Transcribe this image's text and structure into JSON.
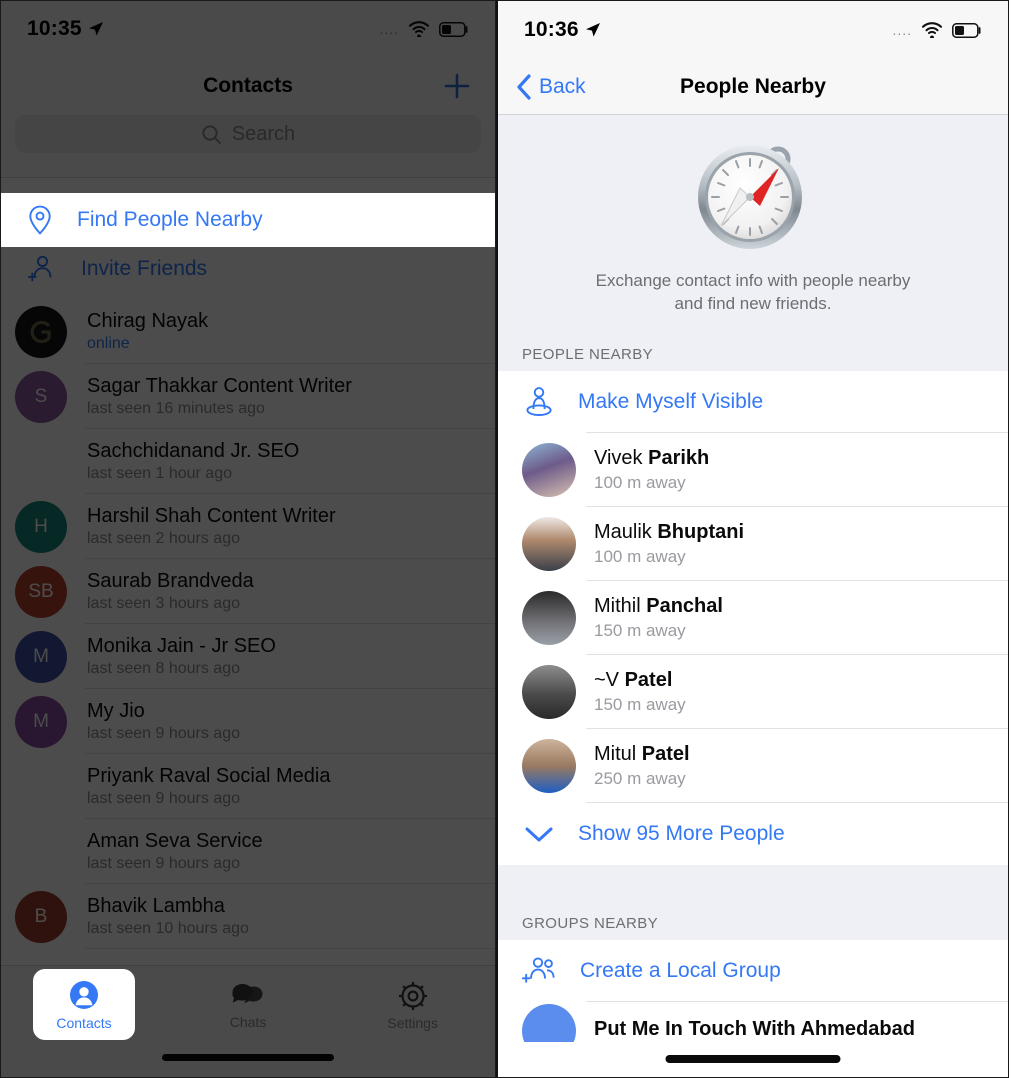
{
  "left": {
    "status": {
      "time": "10:35",
      "location_icon": "location-arrow-icon",
      "signal": "....",
      "wifi_icon": "wifi-icon",
      "battery_icon": "battery-icon"
    },
    "navbar": {
      "title": "Contacts",
      "add_icon": "plus-icon"
    },
    "search": {
      "placeholder": "Search",
      "icon": "search-icon"
    },
    "actions": [
      {
        "label": "Find People Nearby",
        "icon": "map-pin-icon",
        "highlighted": true
      },
      {
        "label": "Invite Friends",
        "icon": "person-add-icon",
        "highlighted": false
      }
    ],
    "contacts": [
      {
        "name": "Chirag Nayak",
        "status": "online",
        "online": true,
        "initials": "G",
        "color": "#151515"
      },
      {
        "name": "Sagar Thakkar Content Writer",
        "status": "last seen 16 minutes ago",
        "online": false,
        "initials": "S",
        "color": "#8c5ca0"
      },
      {
        "name": "Sachchidanand Jr. SEO",
        "status": "last seen 1 hour ago",
        "online": false,
        "initials": "",
        "color": "transparent"
      },
      {
        "name": "Harshil Shah Content Writer",
        "status": "last seen 2 hours ago",
        "online": false,
        "initials": "H",
        "color": "#19897e"
      },
      {
        "name": "Saurab Brandveda",
        "status": "last seen 3 hours ago",
        "online": false,
        "initials": "SB",
        "color": "#b8402f"
      },
      {
        "name": "Monika Jain - Jr SEO",
        "status": "last seen 8 hours ago",
        "online": false,
        "initials": "M",
        "color": "#3f4fa8"
      },
      {
        "name": "My Jio",
        "status": "last seen 9 hours ago",
        "online": false,
        "initials": "M",
        "color": "#8a4aa3"
      },
      {
        "name": "Priyank Raval Social Media",
        "status": "last seen 9 hours ago",
        "online": false,
        "initials": "",
        "color": "transparent"
      },
      {
        "name": "Aman Seva Service",
        "status": "last seen 9 hours ago",
        "online": false,
        "initials": "",
        "color": "transparent"
      },
      {
        "name": "Bhavik Lambha",
        "status": "last seen 10 hours ago",
        "online": false,
        "initials": "B",
        "color": "#9e3a2c"
      }
    ],
    "tabs": [
      {
        "label": "Contacts",
        "icon": "person-circle-icon",
        "active": true
      },
      {
        "label": "Chats",
        "icon": "chat-bubbles-icon",
        "active": false
      },
      {
        "label": "Settings",
        "icon": "gear-icon",
        "active": false
      }
    ]
  },
  "right": {
    "status": {
      "time": "10:36",
      "location_icon": "location-arrow-icon",
      "signal": "....",
      "wifi_icon": "wifi-icon",
      "battery_icon": "battery-icon"
    },
    "navbar": {
      "back_label": "Back",
      "back_icon": "chevron-left-icon",
      "title": "People Nearby"
    },
    "hero": {
      "icon": "compass-icon",
      "line1": "Exchange contact info with people nearby",
      "line2": "and find new friends."
    },
    "people_section": {
      "header": "PEOPLE NEARBY",
      "visible_action": {
        "label": "Make Myself Visible",
        "icon": "person-location-icon"
      },
      "people": [
        {
          "first": "Vivek ",
          "last": "Parikh",
          "distance": "100 m away",
          "avatar_colors": [
            "#6d5b8a",
            "#b9c8d8"
          ]
        },
        {
          "first": "Maulik ",
          "last": "Bhuptani",
          "distance": "100 m away",
          "avatar_colors": [
            "#efe9e6",
            "#4a4a55"
          ]
        },
        {
          "first": "Mithil ",
          "last": "Panchal",
          "distance": "150 m away",
          "avatar_colors": [
            "#2a2a2a",
            "#8d8d92"
          ]
        },
        {
          "first": "~V ",
          "last": "Patel",
          "distance": "150 m away",
          "avatar_colors": [
            "#6e6e6e",
            "#2f2f2f"
          ]
        },
        {
          "first": "Mitul ",
          "last": "Patel",
          "distance": "250 m away",
          "avatar_colors": [
            "#c9b098",
            "#1d5fc4"
          ]
        }
      ],
      "show_more": {
        "label": "Show 95 More People",
        "icon": "chevron-down-icon"
      }
    },
    "groups_section": {
      "header": "GROUPS NEARBY",
      "create_action": {
        "label": "Create a Local Group",
        "icon": "people-add-icon"
      },
      "groups": [
        {
          "name": "Put Me In Touch With Ahmedabad",
          "color": "#5b8def"
        }
      ]
    }
  },
  "colors": {
    "accent": "#3478f6",
    "section_bg": "#eff0f5",
    "separator": "#e2e2e6",
    "muted": "#8e8e93"
  }
}
